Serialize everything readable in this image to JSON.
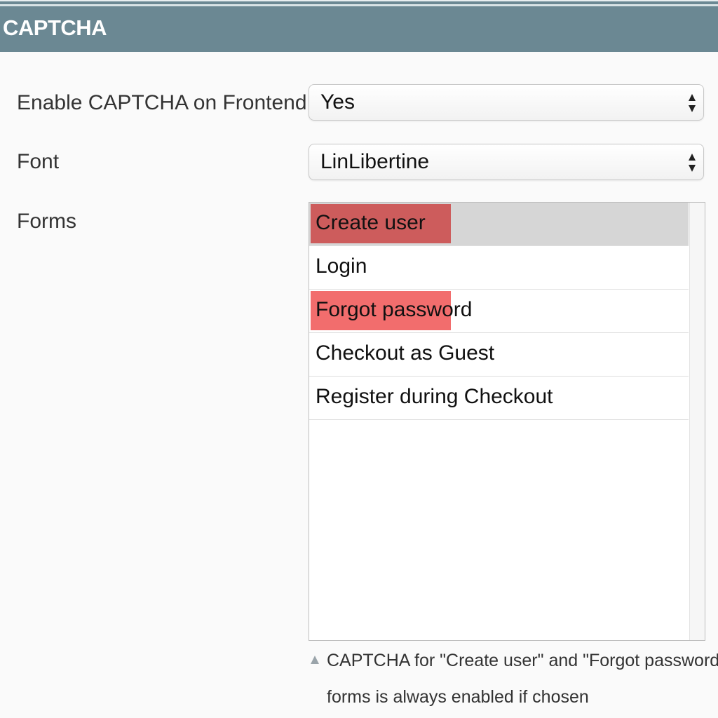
{
  "section": {
    "title": "CAPTCHA"
  },
  "fields": {
    "enable_label": "Enable CAPTCHA on Frontend",
    "enable_value": "Yes",
    "font_label": "Font",
    "font_value": "LinLibertine",
    "forms_label": "Forms"
  },
  "forms_list": {
    "options": [
      {
        "label": "Create user",
        "selected": true
      },
      {
        "label": "Login",
        "selected": false
      },
      {
        "label": "Forgot password",
        "selected": true
      },
      {
        "label": "Checkout as Guest",
        "selected": false
      },
      {
        "label": "Register during Checkout",
        "selected": false
      }
    ]
  },
  "note": {
    "line1": "CAPTCHA for \"Create user\" and \"Forgot password\"",
    "line2": "forms is always enabled if chosen"
  },
  "colors": {
    "header_bg": "#6b8893",
    "highlight_dark": "#cd5c5c",
    "highlight_light": "#f26d6d",
    "selected_row_bg": "#d6d6d6"
  },
  "icons": {
    "select_arrows": "updown-arrows-icon",
    "note": "triangle-note-icon"
  }
}
